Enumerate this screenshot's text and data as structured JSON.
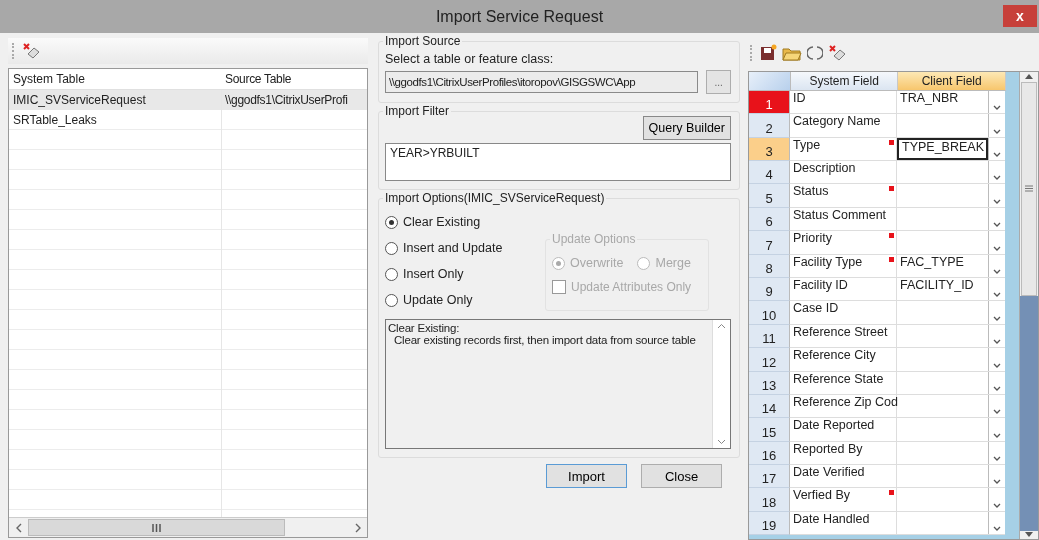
{
  "window": {
    "title": "Import Service Request",
    "close": "x"
  },
  "tables_panel": {
    "columns": [
      "System Table",
      "Source Table"
    ],
    "rows": [
      {
        "system_table": "IMIC_SVServiceRequest",
        "source_table": "\\\\ggodfs1\\CitrixUserProfi",
        "selected": true
      },
      {
        "system_table": "SRTable_Leaks",
        "source_table": "",
        "selected": false
      }
    ]
  },
  "import_source": {
    "title": "Import Source",
    "label": "Select a table or feature class:",
    "value": "\\\\ggodfs1\\CitrixUserProfiles\\itoropov\\GISGSWC\\App",
    "browse": "..."
  },
  "import_filter": {
    "title": "Import Filter",
    "query_builder": "Query Builder",
    "value": "YEAR>YRBUILT"
  },
  "import_options": {
    "title": "Import Options(IMIC_SVServiceRequest)",
    "modes": [
      {
        "label": "Clear Existing",
        "selected": true
      },
      {
        "label": "Insert and Update",
        "selected": false
      },
      {
        "label": "Insert Only",
        "selected": false
      },
      {
        "label": "Update Only",
        "selected": false
      }
    ],
    "update_options": {
      "title": "Update Options",
      "disabled": true,
      "modes": [
        {
          "label": "Overwrite",
          "selected": true
        },
        {
          "label": "Merge",
          "selected": false
        }
      ],
      "attributes_only": {
        "label": "Update Attributes Only",
        "checked": false
      }
    },
    "description": "Clear Existing:\n  Clear existing records first, then import data from source table"
  },
  "buttons": [
    "Import",
    "Close"
  ],
  "field_grid": {
    "columns": [
      "System Field",
      "Client Field"
    ],
    "rows": [
      {
        "number": "1",
        "system_field": "ID",
        "client_field": "TRA_NBR",
        "required": false,
        "error": true,
        "selected": false
      },
      {
        "number": "2",
        "system_field": "Category Name",
        "client_field": "",
        "required": false,
        "error": false,
        "selected": false
      },
      {
        "number": "3",
        "system_field": "Type",
        "client_field": "TYPE_BREAK",
        "required": true,
        "error": false,
        "selected": true
      },
      {
        "number": "4",
        "system_field": "Description",
        "client_field": "",
        "required": false,
        "error": false,
        "selected": false
      },
      {
        "number": "5",
        "system_field": "Status",
        "client_field": "",
        "required": true,
        "error": false,
        "selected": false
      },
      {
        "number": "6",
        "system_field": "Status Comment",
        "client_field": "",
        "required": false,
        "error": false,
        "selected": false
      },
      {
        "number": "7",
        "system_field": "Priority",
        "client_field": "",
        "required": true,
        "error": false,
        "selected": false
      },
      {
        "number": "8",
        "system_field": "Facility Type",
        "client_field": "FAC_TYPE",
        "required": true,
        "error": false,
        "selected": false
      },
      {
        "number": "9",
        "system_field": "Facility ID",
        "client_field": "FACILITY_ID",
        "required": false,
        "error": false,
        "selected": false
      },
      {
        "number": "10",
        "system_field": "Case ID",
        "client_field": "",
        "required": false,
        "error": false,
        "selected": false
      },
      {
        "number": "11",
        "system_field": "Reference Street",
        "client_field": "",
        "required": false,
        "error": false,
        "selected": false
      },
      {
        "number": "12",
        "system_field": "Reference City",
        "client_field": "",
        "required": false,
        "error": false,
        "selected": false
      },
      {
        "number": "13",
        "system_field": "Reference State",
        "client_field": "",
        "required": false,
        "error": false,
        "selected": false
      },
      {
        "number": "14",
        "system_field": "Reference Zip Cod",
        "client_field": "",
        "required": false,
        "error": false,
        "selected": false
      },
      {
        "number": "15",
        "system_field": "Date Reported",
        "client_field": "",
        "required": false,
        "error": false,
        "selected": false
      },
      {
        "number": "16",
        "system_field": "Reported By",
        "client_field": "",
        "required": false,
        "error": false,
        "selected": false
      },
      {
        "number": "17",
        "system_field": "Date Verified",
        "client_field": "",
        "required": false,
        "error": false,
        "selected": false
      },
      {
        "number": "18",
        "system_field": "Verfied By",
        "client_field": "",
        "required": true,
        "error": false,
        "selected": false
      },
      {
        "number": "19",
        "system_field": "Date Handled",
        "client_field": "",
        "required": false,
        "error": false,
        "selected": false
      }
    ]
  }
}
